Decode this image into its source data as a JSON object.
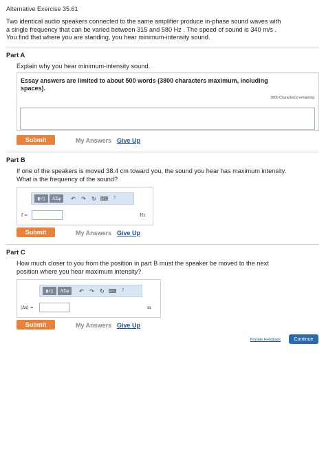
{
  "header": {
    "title": "Alternative Exercise 35.61"
  },
  "intro": {
    "line1": "Two identical audio speakers connected to the same amplifier produce in-phase sound waves with",
    "line2": "a single frequency that can be varied between 315 and 580 Hz . The speed of sound is 340 m/s .",
    "line3": "You find that where you are standing, you hear minimum-intensity sound."
  },
  "partA": {
    "title": "Part A",
    "question": "Explain why you hear minimum-intensity sound.",
    "essay_note_line1": "Essay answers are limited to about 500 words (3800 characters maximum, including",
    "essay_note_line2": "spaces).",
    "chars_remaining": "3800 Character(s) remaining",
    "submit": "Submit",
    "my_answers": "My Answers",
    "give_up": "Give Up"
  },
  "partB": {
    "title": "Part B",
    "question_line1": "If one of the speakers is moved 38.4 cm toward you, the sound you hear has maximum intensity.",
    "question_line2": "What is the frequency of the sound?",
    "toolbar": {
      "templates": "▮√▯",
      "symbols": "ΑΣφ",
      "undo": "↶",
      "redo": "↷",
      "reset": "↻",
      "keyboard": "⌨",
      "help": "?"
    },
    "var_label": "f =",
    "input_value": "",
    "unit": "Hz",
    "submit": "Submit",
    "my_answers": "My Answers",
    "give_up": "Give Up"
  },
  "partC": {
    "title": "Part C",
    "question_line1": "How much closer to you from the position in part B must the speaker be moved to the next",
    "question_line2": "position where you hear maximum intensity?",
    "toolbar": {
      "templates": "▮√▯",
      "symbols": "ΑΣφ",
      "undo": "↶",
      "redo": "↷",
      "reset": "↻",
      "keyboard": "⌨",
      "help": "?"
    },
    "var_label": "|Δx| =",
    "input_value": "",
    "unit": "m",
    "submit": "Submit",
    "my_answers": "My Answers",
    "give_up": "Give Up"
  },
  "footer": {
    "feedback": "Provide Feedback",
    "continue": "Continue"
  }
}
